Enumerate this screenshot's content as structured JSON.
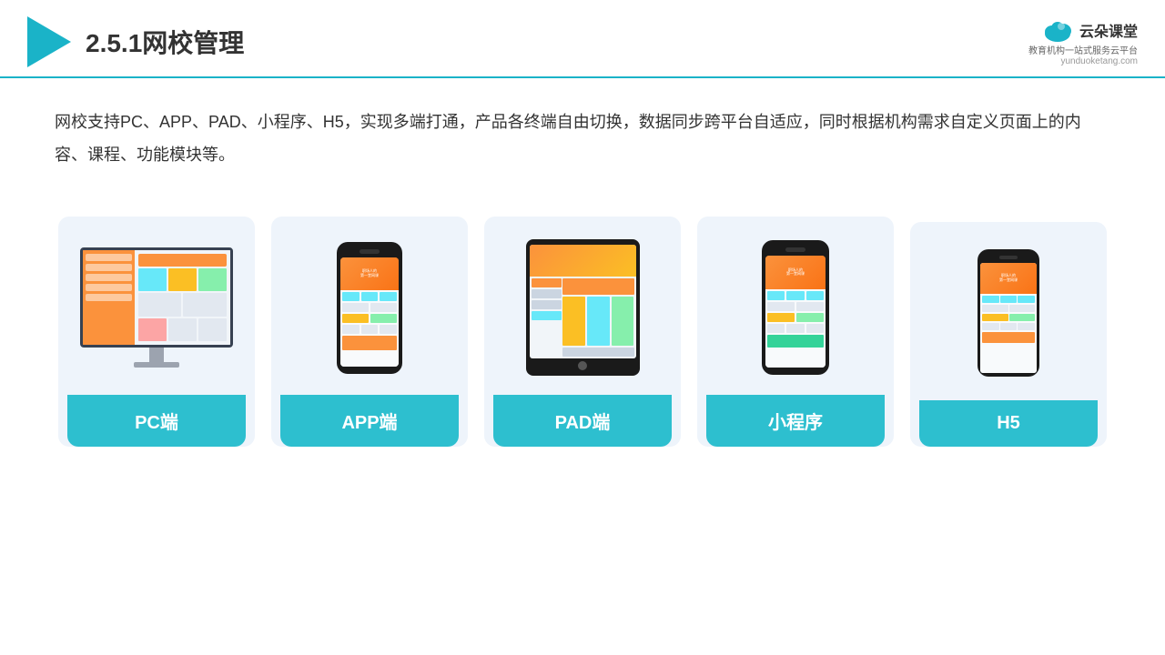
{
  "header": {
    "title": "2.5.1网校管理",
    "brand": {
      "name": "云朵课堂",
      "tagline": "教育机构一站\n式服务云平台",
      "url": "yunduoketang.com"
    }
  },
  "description": "网校支持PC、APP、PAD、小程序、H5，实现多端打通，产品各终端自由切换，数据同步跨平台自适应，同时根据机构需求自定义页面上的内容、课程、功能模块等。",
  "cards": [
    {
      "id": "pc",
      "label": "PC端"
    },
    {
      "id": "app",
      "label": "APP端"
    },
    {
      "id": "pad",
      "label": "PAD端"
    },
    {
      "id": "miniprogram",
      "label": "小程序"
    },
    {
      "id": "h5",
      "label": "H5"
    }
  ],
  "colors": {
    "primary": "#1ab3c8",
    "card_bg": "#eef4fb",
    "card_label": "#2dbfcf"
  }
}
